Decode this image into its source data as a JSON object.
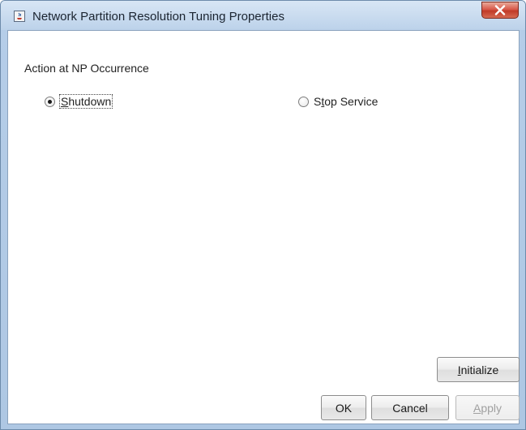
{
  "window": {
    "title": "Network Partition Resolution Tuning Properties"
  },
  "group": {
    "label": "Action at NP Occurrence"
  },
  "options": [
    {
      "mnemonic": "S",
      "rest": "hutdown",
      "checked": true
    },
    {
      "pre": "S",
      "mnemonic": "t",
      "rest": "op Service",
      "checked": false
    }
  ],
  "buttons": {
    "initialize": {
      "mnemonic": "I",
      "rest": "nitialize"
    },
    "ok": "OK",
    "cancel": "Cancel",
    "apply": {
      "mnemonic": "A",
      "rest": "pply",
      "disabled": true
    }
  },
  "icons": {
    "app": "java-cup-icon",
    "close": "close-x-icon"
  }
}
